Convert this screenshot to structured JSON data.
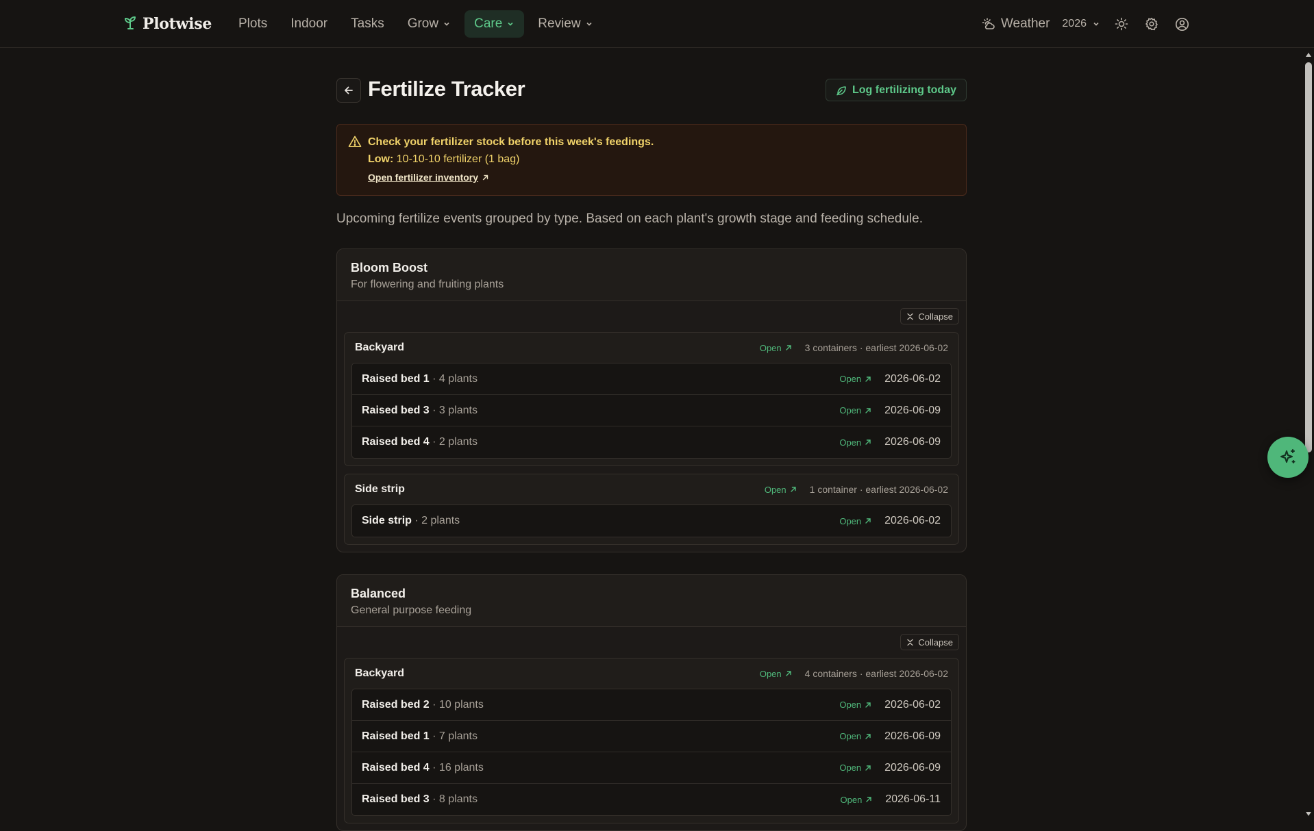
{
  "nav": {
    "brand": "Plotwise",
    "links": [
      {
        "label": "Plots"
      },
      {
        "label": "Indoor"
      },
      {
        "label": "Tasks"
      },
      {
        "label": "Grow"
      },
      {
        "label": "Care"
      },
      {
        "label": "Review"
      }
    ],
    "weather_label": "Weather",
    "year": "2026"
  },
  "page": {
    "title": "Fertilize Tracker",
    "log_button": "Log fertilizing today",
    "intro": "Upcoming fertilize events grouped by type. Based on each plant's growth stage and feeding schedule."
  },
  "alert": {
    "title": "Check your fertilizer stock before this week's feedings.",
    "low_label": "Low:",
    "low_text": "10-10-10 fertilizer (1 bag)",
    "link": "Open fertilizer inventory"
  },
  "labels": {
    "open": "Open",
    "collapse": "Collapse"
  },
  "groups": [
    {
      "name": "Bloom Boost",
      "desc": "For flowering and fruiting plants",
      "plots": [
        {
          "name": "Backyard",
          "meta": "3 containers · earliest 2026-06-02",
          "rows": [
            {
              "name": "Raised bed 1",
              "count": " · 4 plants",
              "date": "2026-06-02"
            },
            {
              "name": "Raised bed 3",
              "count": " · 3 plants",
              "date": "2026-06-09"
            },
            {
              "name": "Raised bed 4",
              "count": " · 2 plants",
              "date": "2026-06-09"
            }
          ]
        },
        {
          "name": "Side strip",
          "meta": "1 container · earliest 2026-06-02",
          "rows": [
            {
              "name": "Side strip",
              "count": " · 2 plants",
              "date": "2026-06-02"
            }
          ]
        }
      ]
    },
    {
      "name": "Balanced",
      "desc": "General purpose feeding",
      "plots": [
        {
          "name": "Backyard",
          "meta": "4 containers · earliest 2026-06-02",
          "rows": [
            {
              "name": "Raised bed 2",
              "count": " · 10 plants",
              "date": "2026-06-02"
            },
            {
              "name": "Raised bed 1",
              "count": " · 7 plants",
              "date": "2026-06-09"
            },
            {
              "name": "Raised bed 4",
              "count": " · 16 plants",
              "date": "2026-06-09"
            },
            {
              "name": "Raised bed 3",
              "count": " · 8 plants",
              "date": "2026-06-11"
            }
          ]
        }
      ]
    }
  ],
  "colors": {
    "accent": "#5ec98a",
    "warning": "#f1d36a",
    "background": "#161412"
  }
}
